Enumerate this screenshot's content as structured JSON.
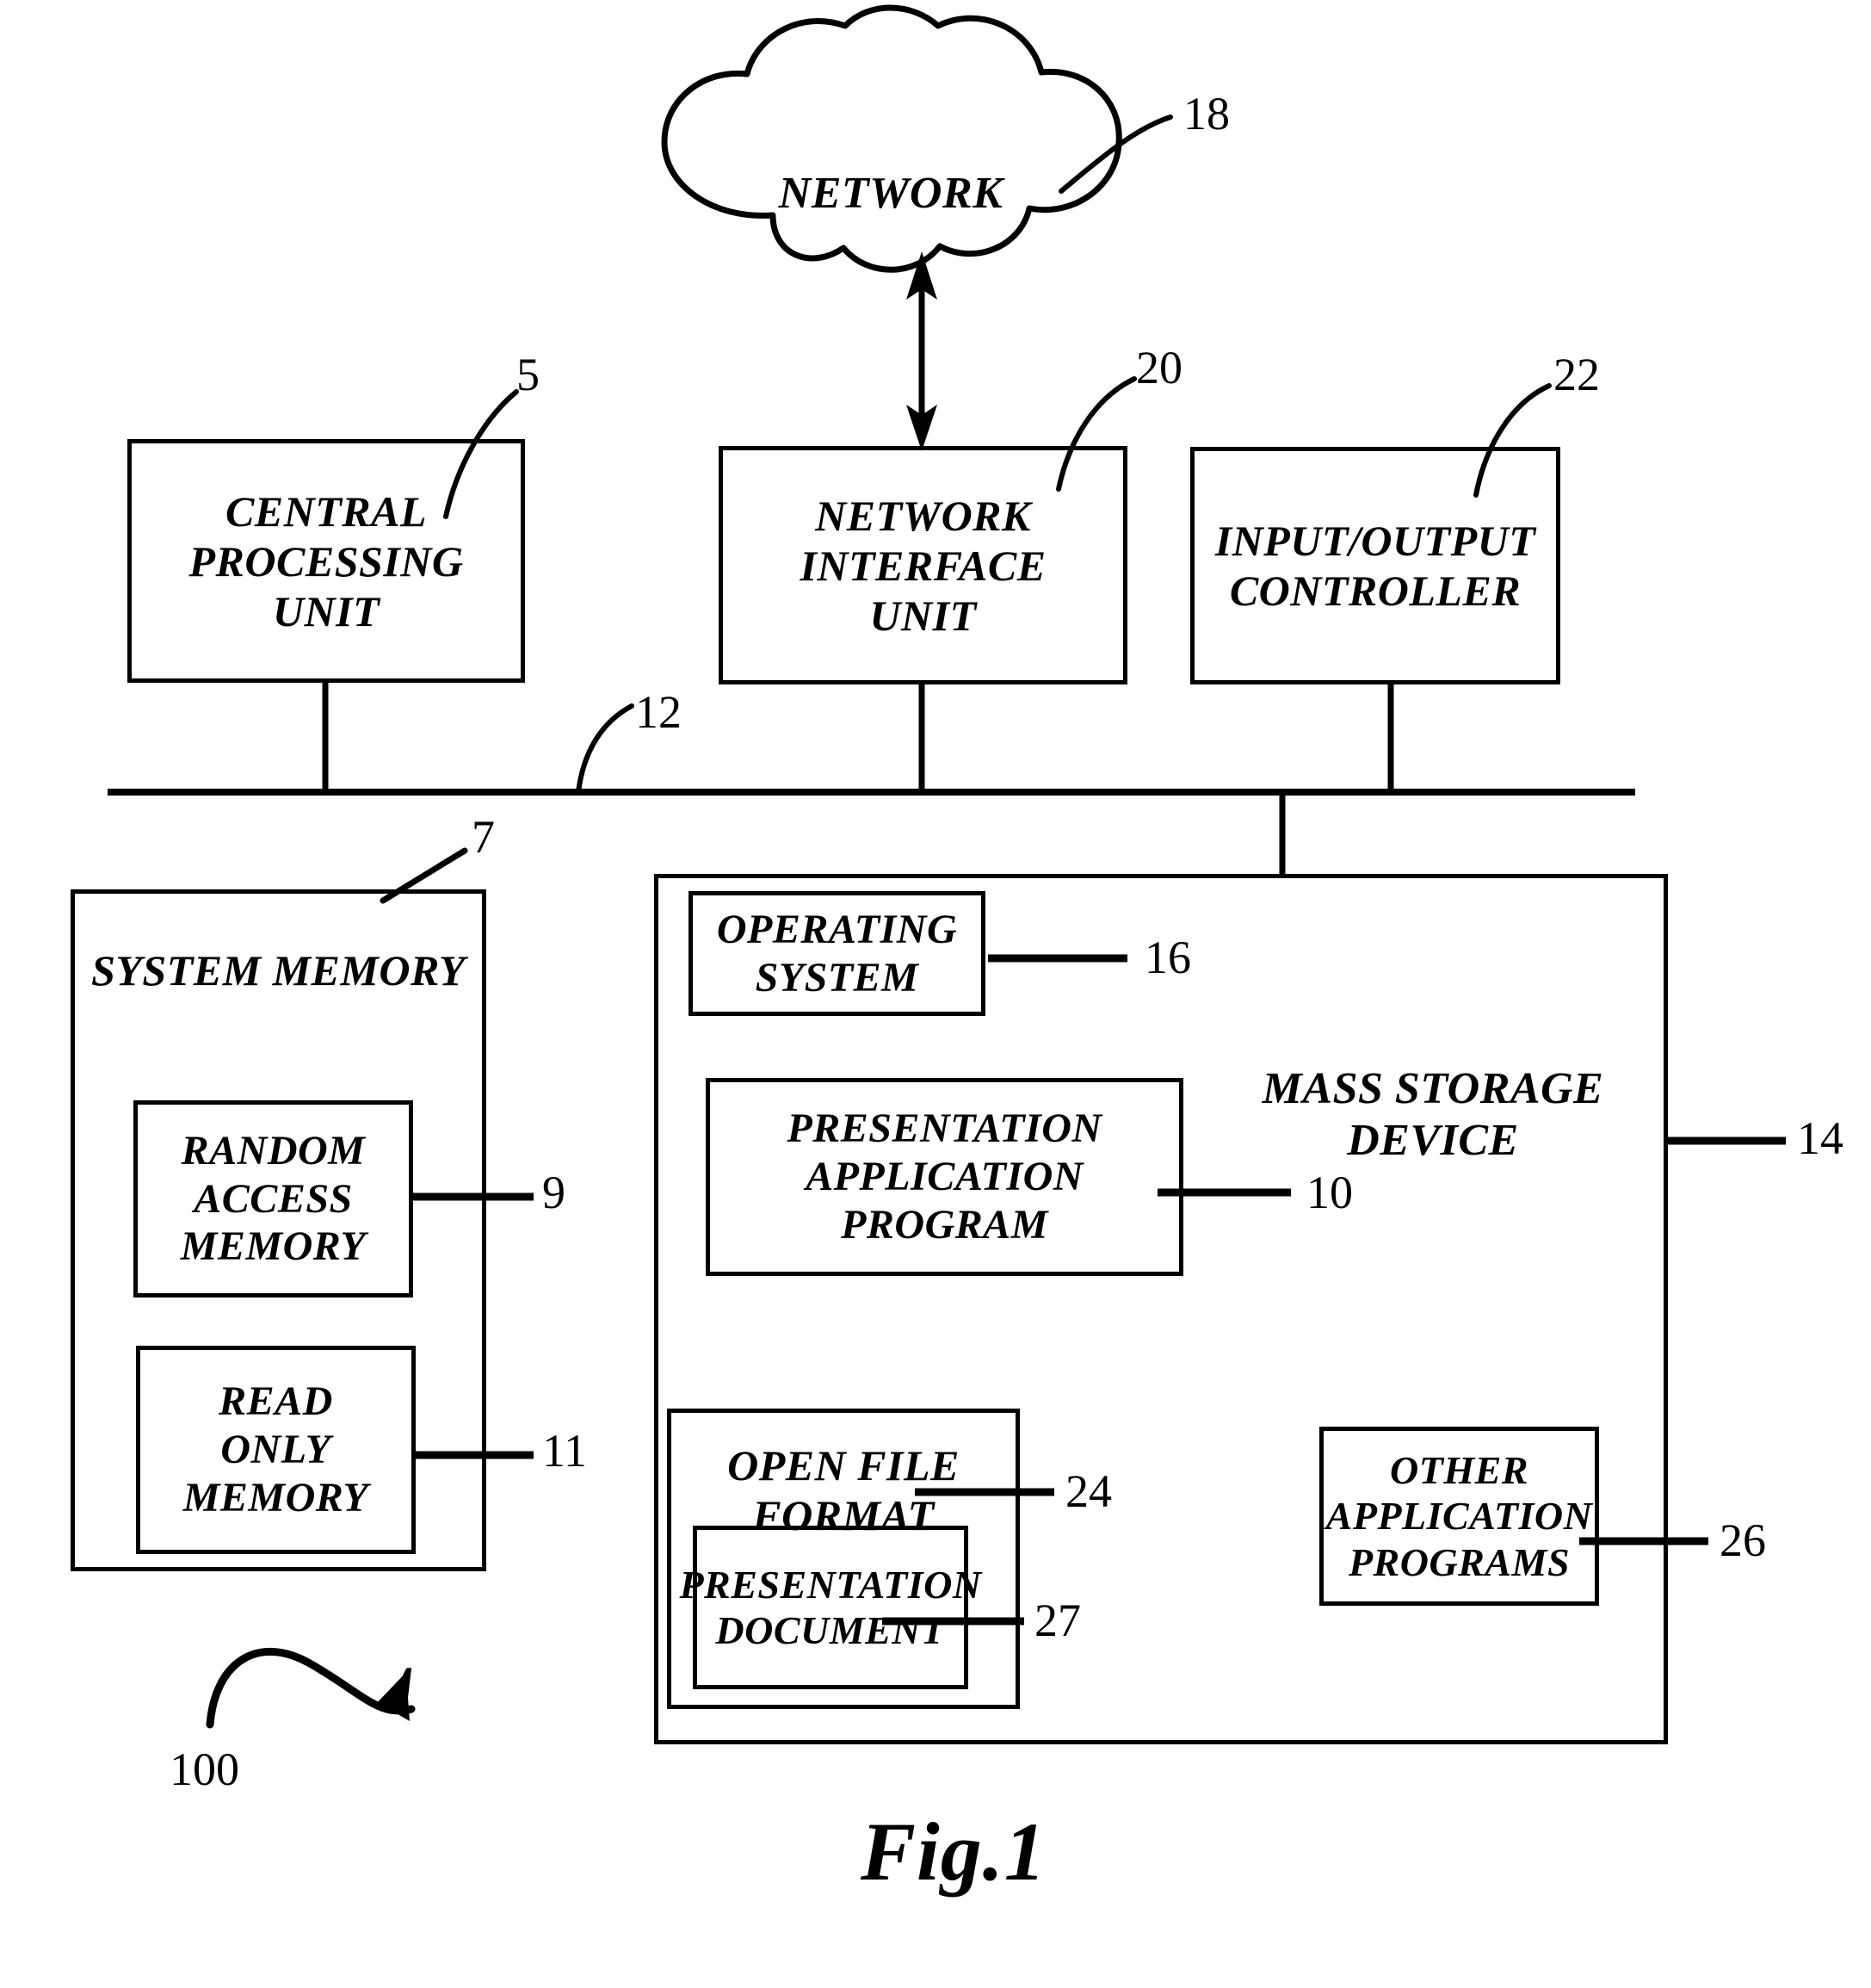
{
  "figure": {
    "caption": "Fig.1",
    "system_ref": "100"
  },
  "cloud": {
    "label": "NETWORK",
    "ref": "18"
  },
  "boxes": [
    {
      "id": "cpu",
      "label": "CENTRAL\nPROCESSING\nUNIT",
      "ref": "5"
    },
    {
      "id": "niu",
      "label": "NETWORK\nINTERFACE\nUNIT",
      "ref": "20"
    },
    {
      "id": "ioc",
      "label": "INPUT/OUTPUT\nCONTROLLER",
      "ref": "22"
    },
    {
      "id": "sysmem",
      "label": "SYSTEM MEMORY",
      "ref": "7"
    },
    {
      "id": "ram",
      "label": "RANDOM\nACCESS\nMEMORY",
      "ref": "9"
    },
    {
      "id": "rom",
      "label": "READ\nONLY\nMEMORY",
      "ref": "11"
    },
    {
      "id": "mass",
      "label": "MASS STORAGE\nDEVICE",
      "ref": "14"
    },
    {
      "id": "os",
      "label": "OPERATING\nSYSTEM",
      "ref": "16"
    },
    {
      "id": "pap",
      "label": "PRESENTATION\nAPPLICATION\nPROGRAM",
      "ref": "10"
    },
    {
      "id": "off",
      "label": "OPEN FILE FORMAT",
      "ref": "24"
    },
    {
      "id": "pdoc",
      "label": "PRESENTATION\nDOCUMENT",
      "ref": "27"
    },
    {
      "id": "oap",
      "label": "OTHER\nAPPLICATION\nPROGRAMS",
      "ref": "26"
    }
  ],
  "bus": {
    "ref": "12"
  },
  "colors": {
    "ink": "#000000",
    "paper": "#ffffff"
  }
}
